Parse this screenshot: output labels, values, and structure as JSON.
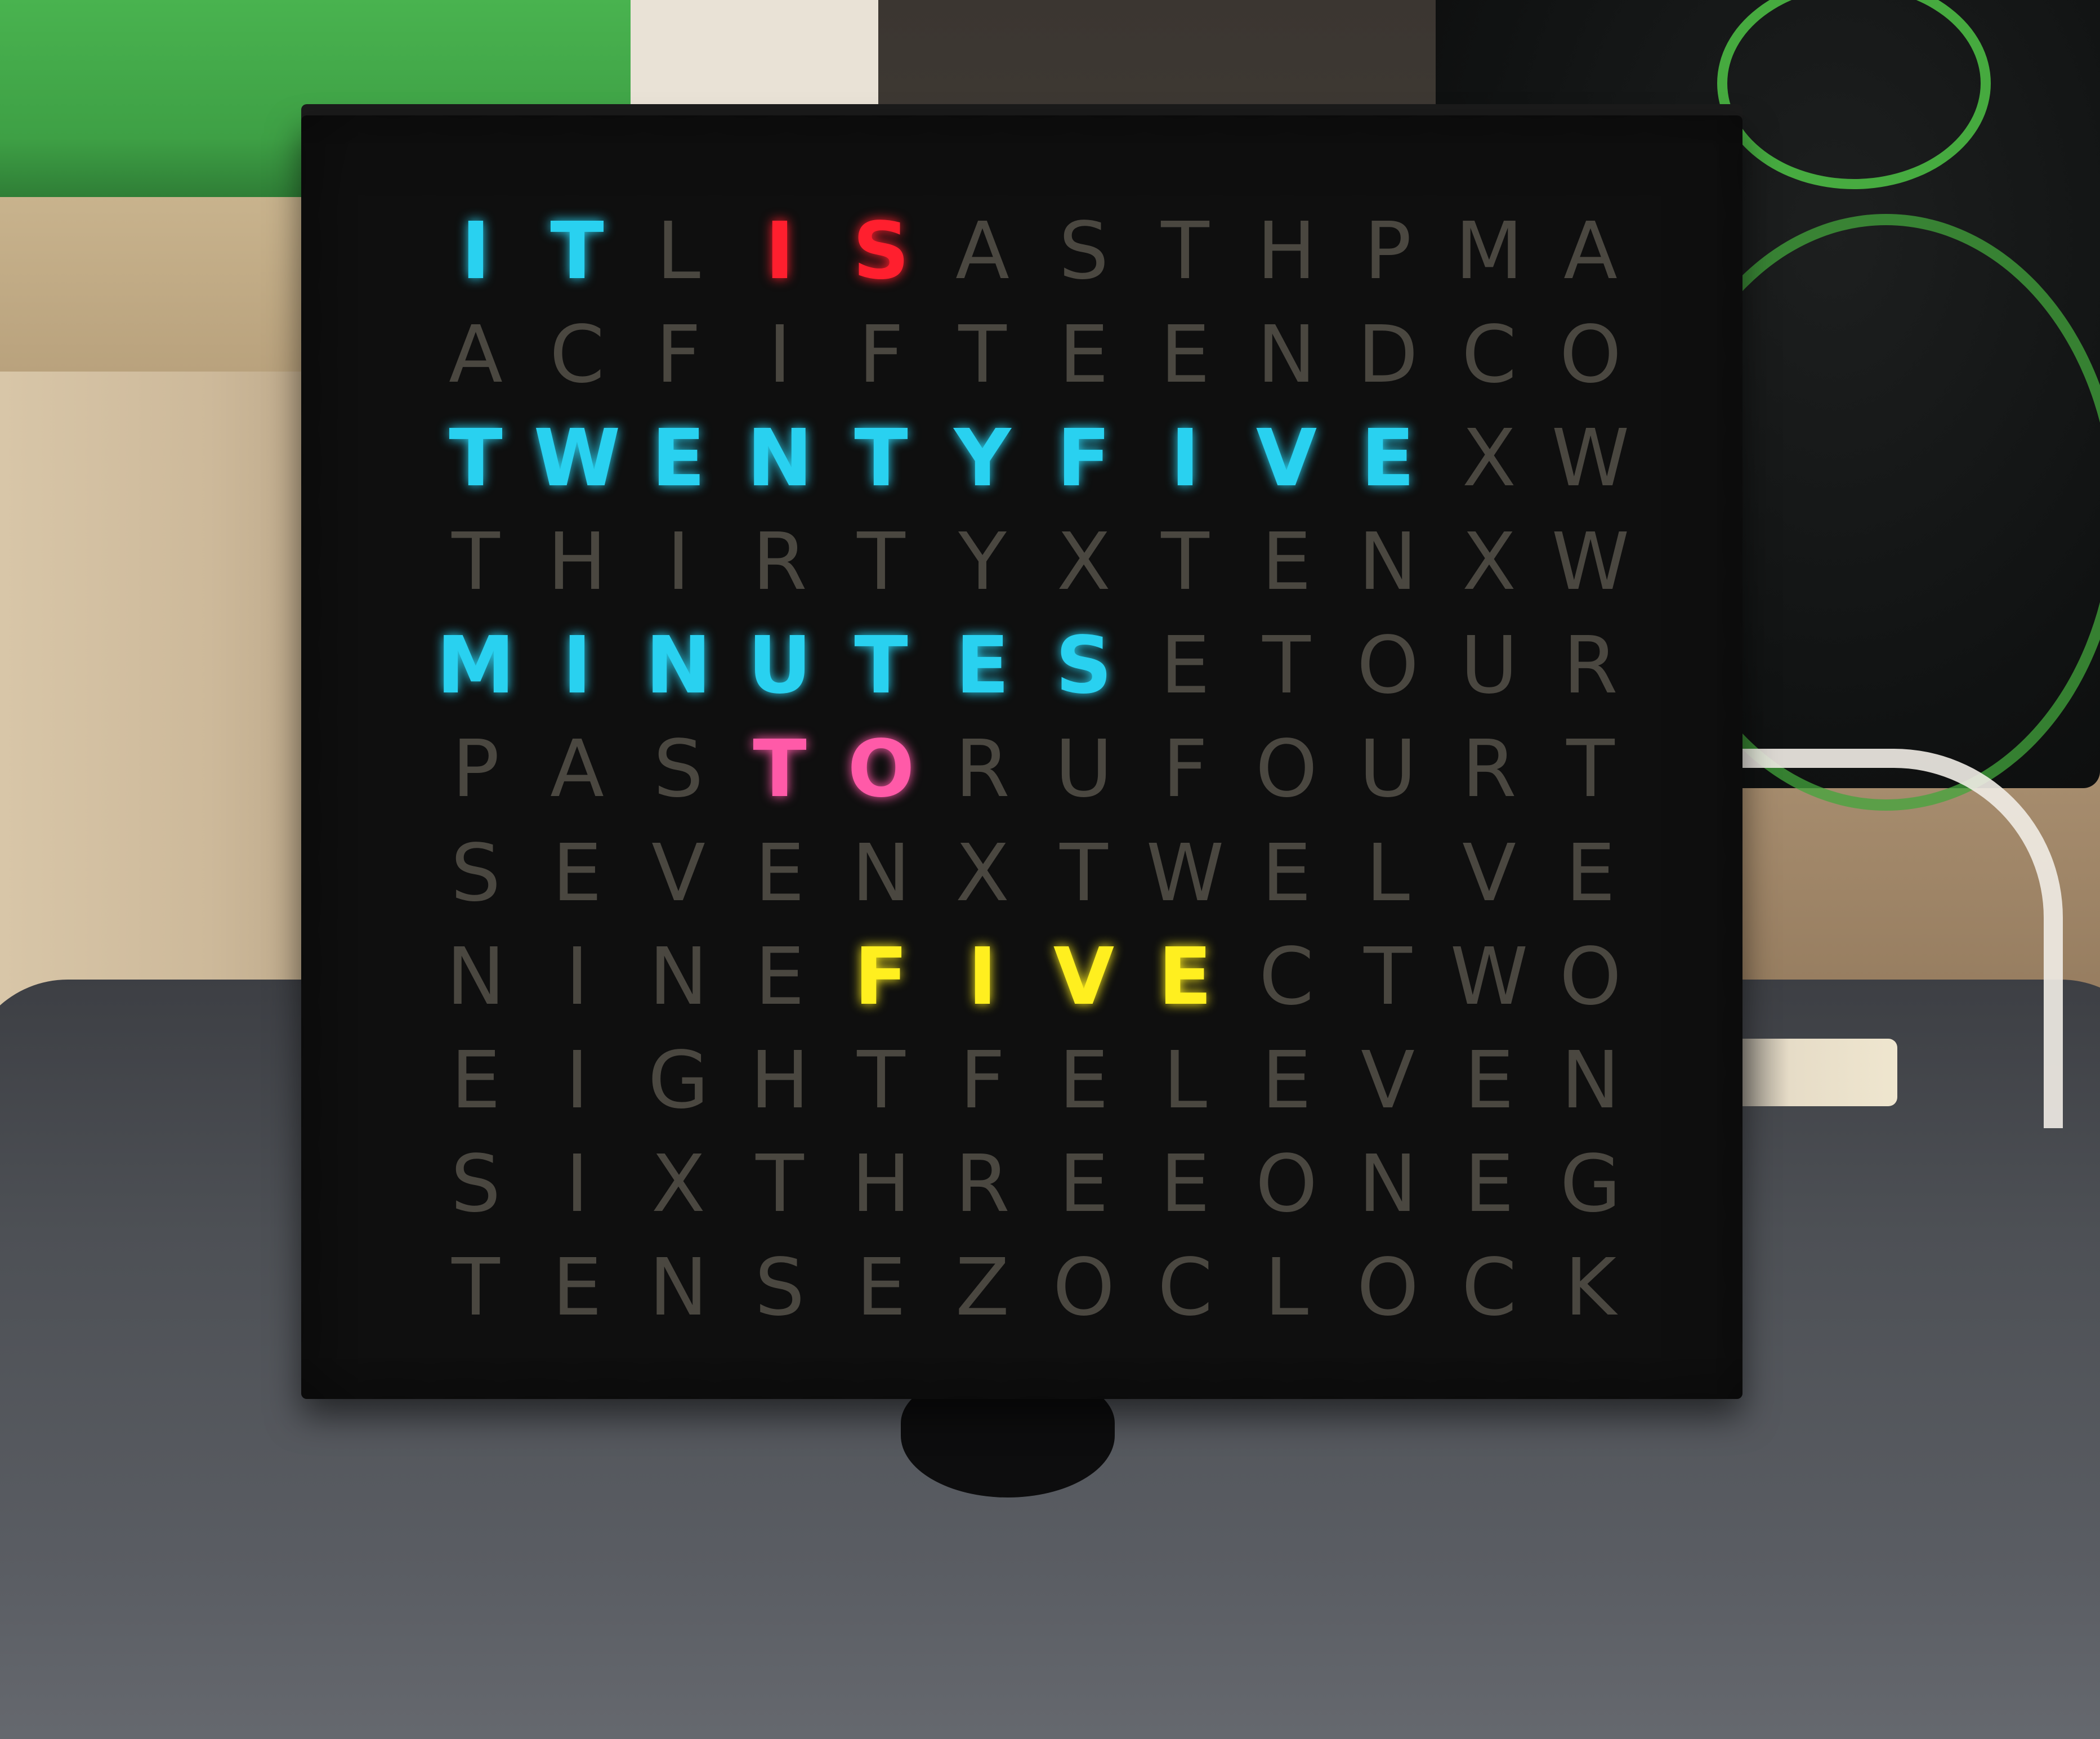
{
  "clock": {
    "rows": [
      "ITLISASTHPMA",
      "ACFIFTEENDCO",
      "TWENTYFIVEXW",
      "THIRTYXTENXW",
      "MINUTESETOUR",
      "PASTORUFOURT",
      "SEVENXTWELVE",
      "NINEFIVECTWO",
      "EIGHTFELEVEN",
      "SIXTHREEONEG",
      "TENSEZOCLOCK"
    ],
    "lit_words": [
      {
        "word": "IT",
        "row": 0,
        "start": 0,
        "color": "#29d1f0"
      },
      {
        "word": "IS",
        "row": 0,
        "start": 3,
        "color": "#ff1f2e"
      },
      {
        "word": "TWENTYFIVE",
        "row": 2,
        "start": 0,
        "color": "#29d1f0"
      },
      {
        "word": "MINUTES",
        "row": 4,
        "start": 0,
        "color": "#29d1f0"
      },
      {
        "word": "TO",
        "row": 5,
        "start": 3,
        "color": "#ff5aa8"
      },
      {
        "word": "FIVE",
        "row": 7,
        "start": 4,
        "color": "#ffef1f"
      }
    ],
    "unlit_color": "#4a4740"
  }
}
